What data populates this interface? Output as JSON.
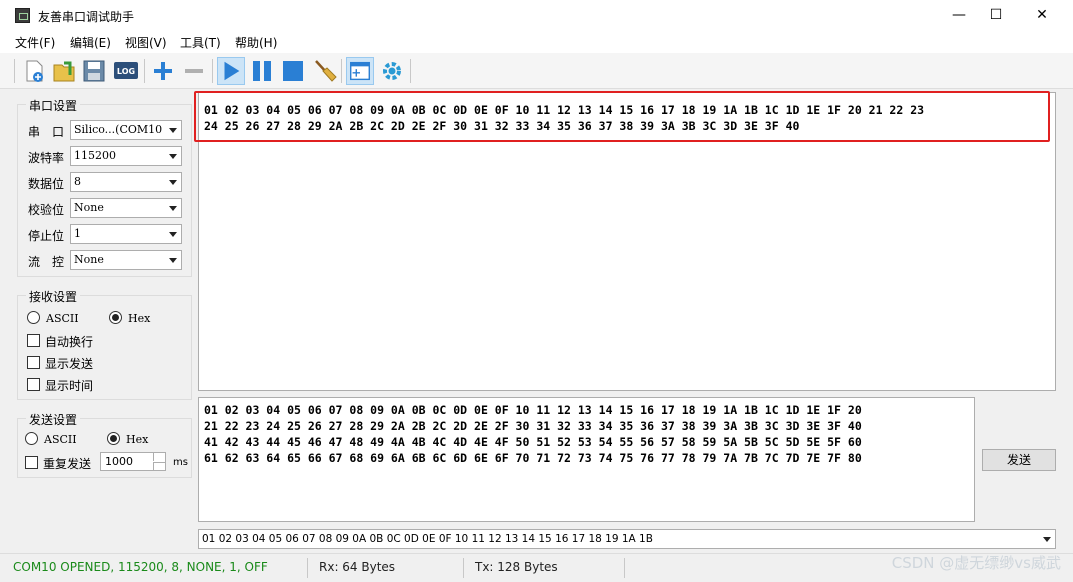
{
  "window": {
    "title": "友善串口调试助手",
    "minimize": "—",
    "maximize": "☐",
    "close": "✕"
  },
  "menu": [
    "文件(F)",
    "编辑(E)",
    "视图(V)",
    "工具(T)",
    "帮助(H)"
  ],
  "toolbar": {
    "log_label": "LOG"
  },
  "serial_settings": {
    "title": "串口设置",
    "rows": [
      {
        "label": "串　口",
        "value": "Silico...(COM10"
      },
      {
        "label": "波特率",
        "value": "115200"
      },
      {
        "label": "数据位",
        "value": "8"
      },
      {
        "label": "校验位",
        "value": "None"
      },
      {
        "label": "停止位",
        "value": "1"
      },
      {
        "label": "流　控",
        "value": "None"
      }
    ]
  },
  "receive_settings": {
    "title": "接收设置",
    "ascii": "ASCII",
    "hex": "Hex",
    "auto_newline": "自动换行",
    "show_send": "显示发送",
    "show_time": "显示时间"
  },
  "send_settings": {
    "title": "发送设置",
    "ascii": "ASCII",
    "hex": "Hex",
    "repeat": "重复发送",
    "interval": "1000",
    "unit": "ms"
  },
  "receive_text": {
    "line1": "01 02 03 04 05 06 07 08 09 0A 0B 0C 0D 0E 0F 10 11 12 13 14 15 16 17 18 19 1A 1B 1C 1D 1E 1F 20 21 22 23",
    "line2": "24 25 26 27 28 29 2A 2B 2C 2D 2E 2F 30 31 32 33 34 35 36 37 38 39 3A 3B 3C 3D 3E 3F 40"
  },
  "send_text": {
    "line1": "01 02 03 04 05 06 07 08 09 0A 0B 0C 0D 0E 0F 10 11 12 13 14 15 16 17 18 19 1A 1B 1C 1D 1E 1F 20",
    "line2": "21 22 23 24 25 26 27 28 29 2A 2B 2C 2D 2E 2F 30 31 32 33 34 35 36 37 38 39 3A 3B 3C 3D 3E 3F 40",
    "line3": "41 42 43 44 45 46 47 48 49 4A 4B 4C 4D 4E 4F 50 51 52 53 54 55 56 57 58 59 5A 5B 5C 5D 5E 5F 60",
    "line4": "61 62 63 64 65 66 67 68 69 6A 6B 6C 6D 6E 6F 70 71 72 73 74 75 76 77 78 79 7A 7B 7C 7D 7E 7F 80"
  },
  "send_button": "发送",
  "history": "01 02 03 04 05 06 07 08 09 0A 0B 0C 0D 0E 0F 10 11 12 13 14 15 16 17 18 19 1A 1B",
  "status": {
    "port": "COM10 OPENED, 115200, 8, NONE, 1, OFF",
    "rx": "Rx: 64 Bytes",
    "tx": "Tx: 128 Bytes"
  },
  "watermark": "CSDN @虚无缥缈vs威武",
  "colors": {
    "status_green": "#1a8a1a",
    "highlight_red": "#e02020",
    "toolbar_blue": "#2a7fd4"
  }
}
